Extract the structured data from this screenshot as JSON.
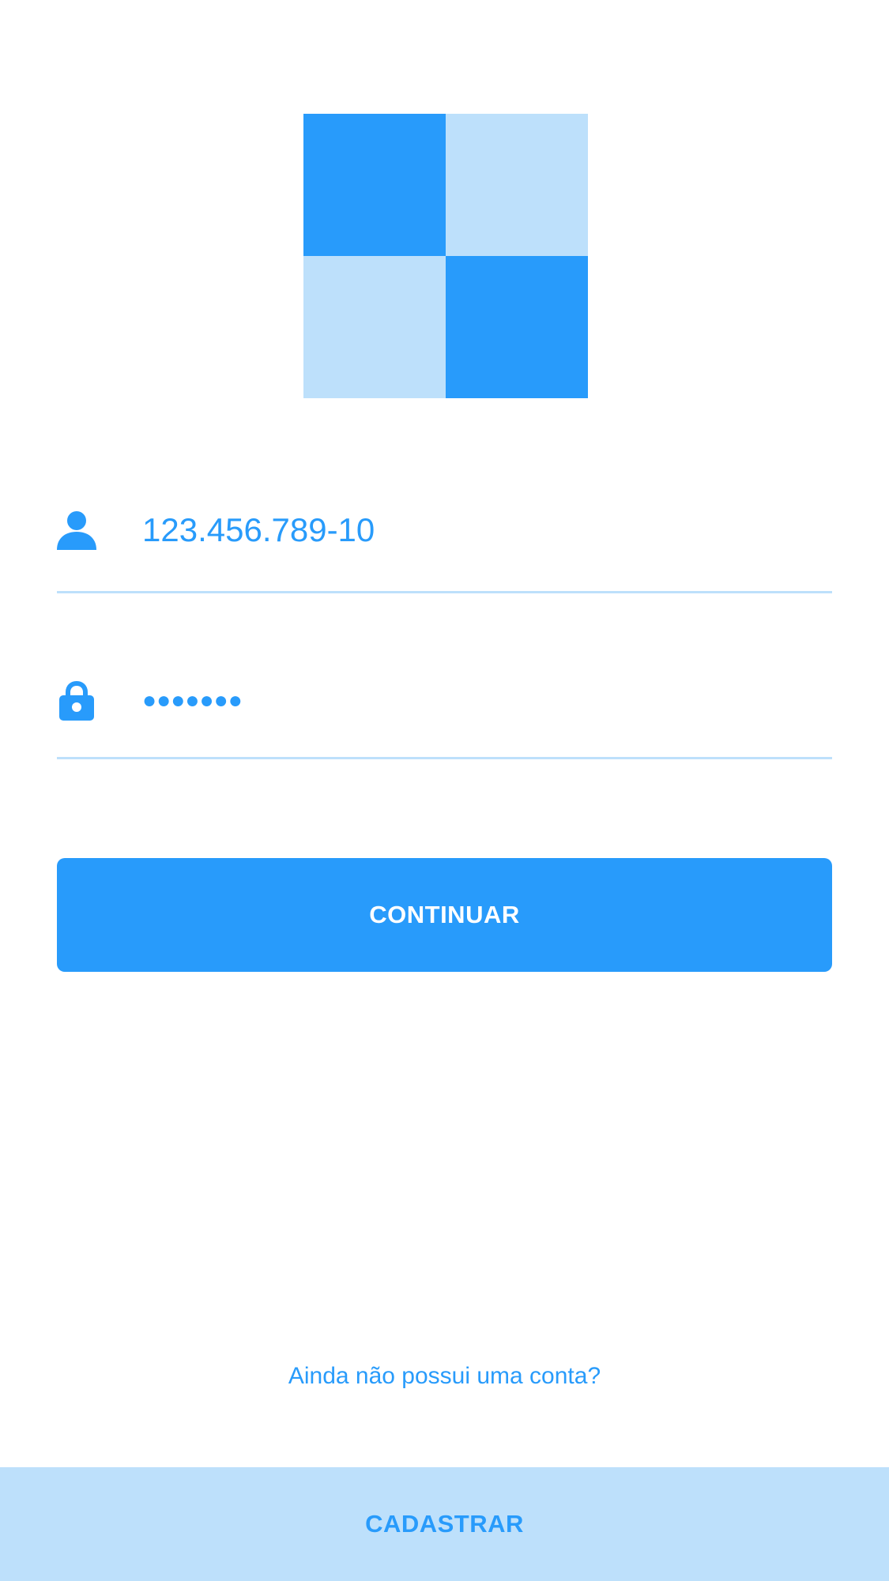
{
  "colors": {
    "primary": "#289bfb",
    "primary_light": "#bde0fb",
    "background": "#ffffff",
    "button_text": "#ffffff"
  },
  "logo": {
    "squares": [
      "primary",
      "primary_light",
      "primary_light",
      "primary"
    ]
  },
  "login": {
    "username": {
      "icon": "person-icon",
      "value": "123.456.789-10"
    },
    "password": {
      "icon": "lock-icon",
      "value": "●●●●●●●"
    }
  },
  "actions": {
    "continue_label": "CONTINUAR",
    "no_account_text": "Ainda não possui uma conta?",
    "register_label": "CADASTRAR"
  }
}
